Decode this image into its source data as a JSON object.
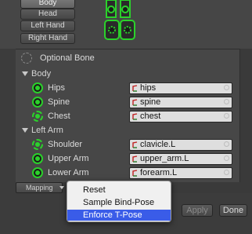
{
  "body_parts": {
    "buttons": [
      {
        "label": "Body",
        "active": true
      },
      {
        "label": "Head",
        "active": false
      },
      {
        "label": "Left Hand",
        "active": false
      },
      {
        "label": "Right Hand",
        "active": false
      }
    ]
  },
  "bone_list": {
    "optional_legend": "Optional Bone",
    "sections": [
      {
        "title": "Body",
        "bones": [
          {
            "label": "Hips",
            "value": "hips",
            "icon": "bone-required-icon"
          },
          {
            "label": "Spine",
            "value": "spine",
            "icon": "bone-required-icon"
          },
          {
            "label": "Chest",
            "value": "chest",
            "icon": "bone-optional-icon"
          }
        ]
      },
      {
        "title": "Left Arm",
        "bones": [
          {
            "label": "Shoulder",
            "value": "clavicle.L",
            "icon": "bone-optional-icon"
          },
          {
            "label": "Upper Arm",
            "value": "upper_arm.L",
            "icon": "bone-required-icon"
          },
          {
            "label": "Lower Arm",
            "value": "forearm.L",
            "icon": "bone-required-icon"
          }
        ]
      }
    ]
  },
  "mapping": {
    "label": "Mapping"
  },
  "popup_menu": {
    "items": [
      {
        "label": "Reset",
        "selected": false
      },
      {
        "label": "Sample Bind-Pose",
        "selected": false
      },
      {
        "label": "Enforce T-Pose",
        "selected": true
      }
    ]
  },
  "footer": {
    "apply_label": "Apply",
    "done_label": "Done"
  },
  "colors": {
    "bone_green": "#2bd12b",
    "menu_highlight": "#3a5ce8"
  }
}
